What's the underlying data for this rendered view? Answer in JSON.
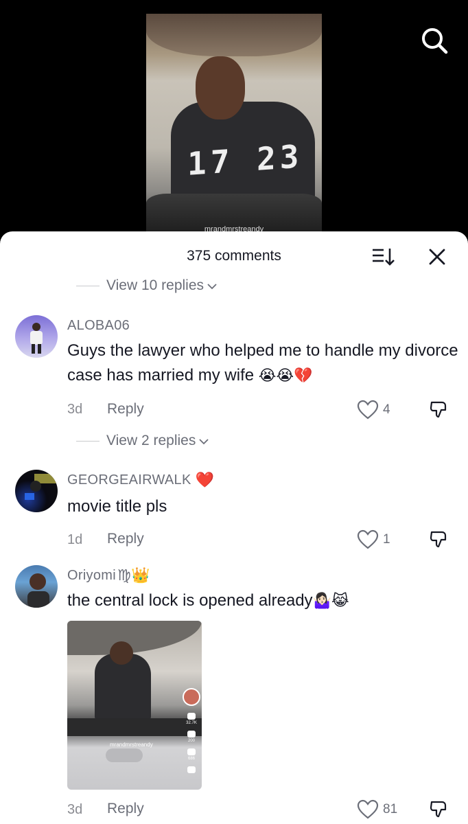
{
  "video": {
    "jersey_number": "17 23",
    "watermark": "mrandmrstreandy"
  },
  "header": {
    "comment_count": "375 comments",
    "sort_icon": "sort-icon",
    "close_icon": "close-icon",
    "search_icon": "search-icon"
  },
  "thread_top": {
    "view_replies": "View 10 replies"
  },
  "comments": [
    {
      "username": "ALOBA06",
      "text": "Guys the lawyer who helped me to handle my divorce case has married my wife",
      "emojis": "😭😭💔",
      "time": "3d",
      "reply": "Reply",
      "likes": "4",
      "view_replies": "View 2 replies"
    },
    {
      "username": "GEORGEAIRWALK",
      "badge": "❤️",
      "text": "movie title pls",
      "time": "1d",
      "reply": "Reply",
      "likes": "1"
    },
    {
      "username": "Oriyomi",
      "badge": "♍👑",
      "text": "the central lock is opened already",
      "emojis": "🤷🏻‍♀️😹",
      "time": "3d",
      "reply": "Reply",
      "likes": "81",
      "attachment": {
        "username": "mrandmrstreandy",
        "likes": "32.7K",
        "comments": "200",
        "saves": "686"
      }
    }
  ],
  "colors": {
    "sheet_bg": "#ffffff",
    "text_primary": "#161823",
    "text_secondary": "#6b6e78",
    "heart_red": "#fe2c55"
  }
}
